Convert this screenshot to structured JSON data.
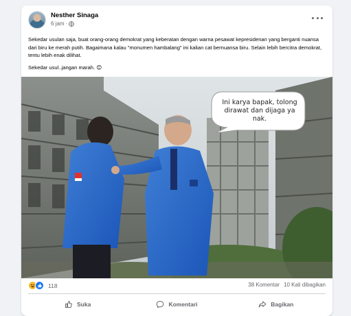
{
  "post": {
    "author": "Nesther Sinaga",
    "time": "6 jam",
    "separator": "·",
    "paragraph1": "Sekedar usulan saja, buat orang-orang demokrat yang keberatan dengan warna pesawat kepresidenan yang berganti nuansa dari biru ke merah putih. Bagaimana kalau \"monumen hambalang\" ini kalian cat bernuansa biru. Selain lebih bercitra demokrat, tentu lebih enak dilihat.",
    "paragraph2": "Sekedar usul..jangan marah. 😊"
  },
  "image": {
    "speech_bubble": "Ini karya bapak, tolong dirawat dan dijaga ya nak."
  },
  "stats": {
    "reaction_count": "118",
    "comments": "38 Komentar",
    "shares": "10 Kali dibagikan"
  },
  "actions": {
    "like": "Suka",
    "comment": "Komentari",
    "share": "Bagikan"
  },
  "colors": {
    "text": "#050505",
    "secondary": "#65676b",
    "like_blue": "#1877f2",
    "haha_yellow": "#f7b928"
  }
}
